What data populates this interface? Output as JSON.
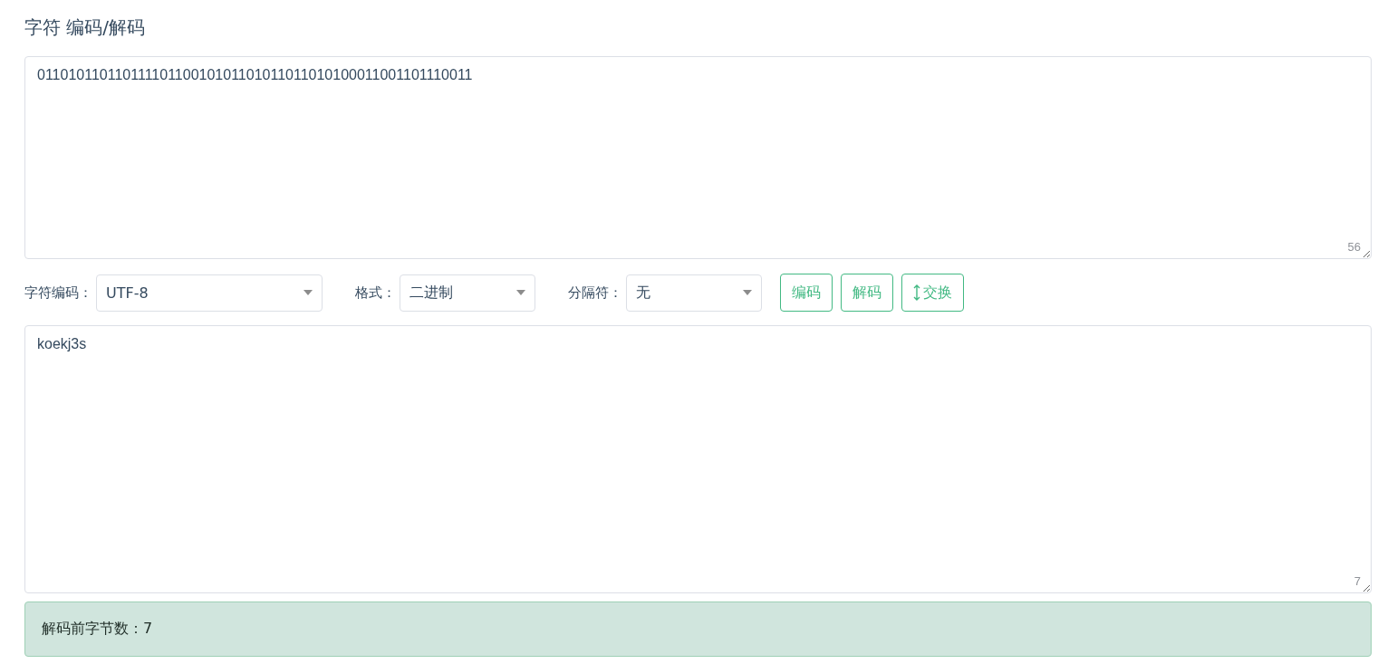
{
  "title": "字符 编码/解码",
  "input": {
    "value": "01101011011011110110010101101011011010100011001101110011",
    "count": "56"
  },
  "options": [
    {
      "label": "字符编码：",
      "value": "UTF-8"
    },
    {
      "label": "格式：",
      "value": "二进制"
    },
    {
      "label": "分隔符：",
      "value": "无"
    }
  ],
  "buttons": [
    {
      "label": "编码",
      "kind": "plain"
    },
    {
      "label": "解码",
      "kind": "plain"
    },
    {
      "label": "交换",
      "kind": "swap"
    }
  ],
  "output": {
    "value": "koekj3s",
    "count": "7"
  },
  "result": "解码前字节数：7"
}
